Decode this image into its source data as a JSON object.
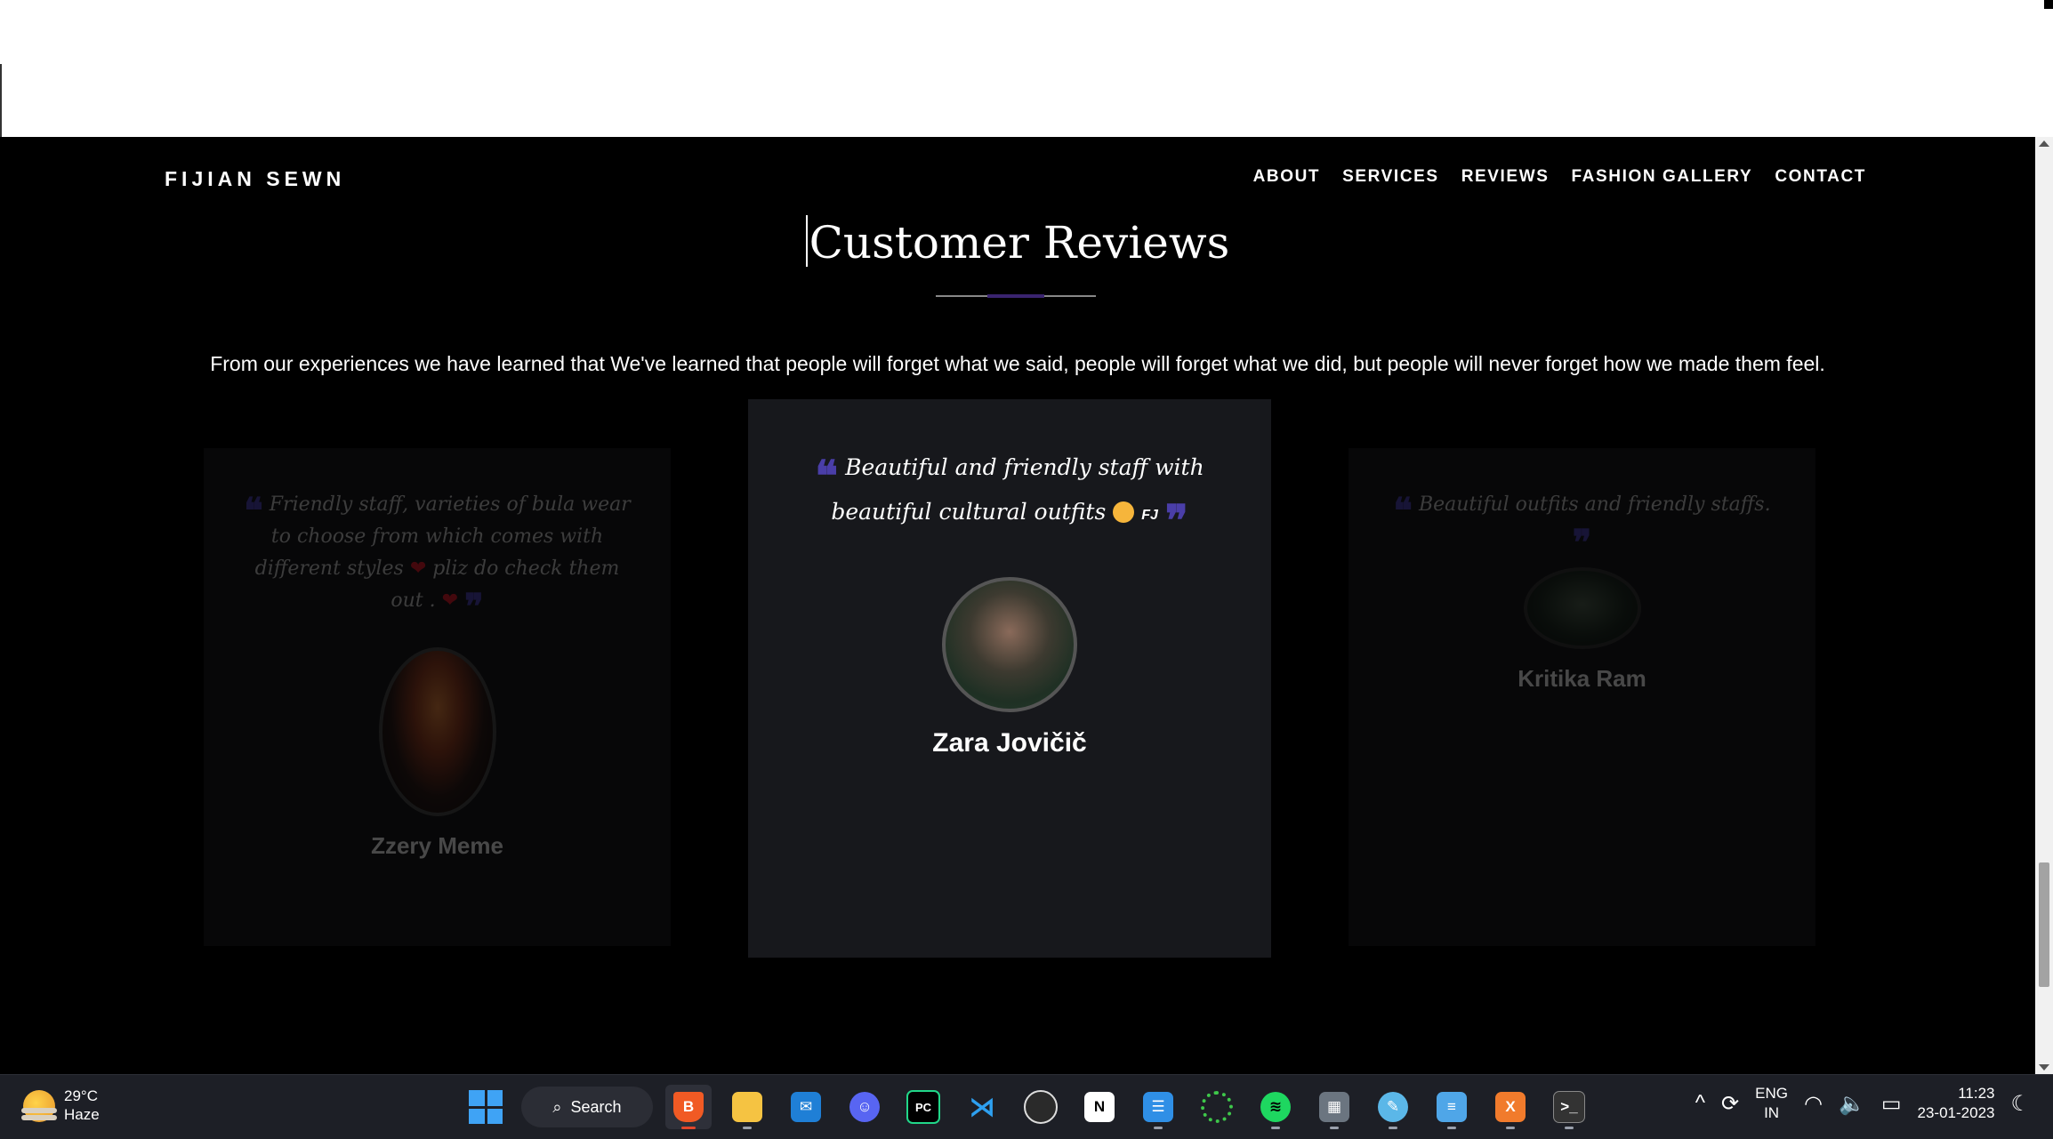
{
  "site": {
    "brand": "FIJIAN SEWN",
    "nav": [
      "ABOUT",
      "SERVICES",
      "REVIEWS",
      "FASHION GALLERY",
      "CONTACT"
    ],
    "section_title": "Customer Reviews",
    "intro": "From our experiences we have learned that We've learned that people will forget what we said, people will forget what we did, but people will never forget how we made them feel."
  },
  "reviews": [
    {
      "text": "Friendly staff, varieties of bula wear to choose from which comes with different styles",
      "text_after_heart": "pliz do check them out .",
      "name": "Zzery Meme"
    },
    {
      "text": "Beautiful and friendly staff with beautiful cultural outfits",
      "tag": "FJ",
      "name": "Zara Jovičič"
    },
    {
      "text": "Beautiful outfits and friendly staffs.",
      "name": "Kritika Ram"
    }
  ],
  "quote_open": "❝",
  "quote_close": "❞",
  "colors": {
    "page_bg": "#000000",
    "card_bg": "#17181c",
    "quote_accent": "#4a3ea8",
    "heart": "#d11a2a",
    "underline_accent": "#3a2470"
  },
  "taskbar": {
    "weather": {
      "temp": "29°C",
      "desc": "Haze"
    },
    "search_label": "Search",
    "apps": [
      "brave-icon",
      "file-explorer-icon",
      "mail-icon",
      "discord-icon",
      "pycharm-icon",
      "vscode-icon",
      "obs-icon",
      "notion-icon",
      "teams-icon",
      "loader-icon",
      "spotify-icon",
      "calculator-icon",
      "paint-icon",
      "notepad-icon",
      "xampp-icon",
      "terminal-icon"
    ],
    "tray": {
      "lang_line1": "ENG",
      "lang_line2": "IN",
      "time": "11:23",
      "date": "23-01-2023"
    }
  }
}
